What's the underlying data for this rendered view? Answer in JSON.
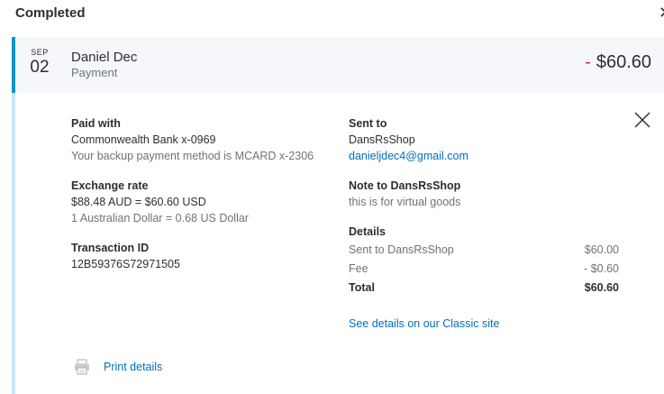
{
  "section": {
    "title": "Completed"
  },
  "transaction": {
    "date_month": "SEP",
    "date_day": "02",
    "party_name": "Daniel Dec",
    "type": "Payment",
    "amount_sign": "-",
    "amount": "$60.60"
  },
  "paid_with": {
    "label": "Paid with",
    "account": "Commonwealth Bank x-0969",
    "backup": "Your backup payment method is MCARD x-2306"
  },
  "exchange": {
    "label": "Exchange rate",
    "conversion": "$88.48 AUD = $60.60 USD",
    "rate": "1 Australian Dollar = 0.68 US Dollar"
  },
  "transaction_id": {
    "label": "Transaction ID",
    "value": "12B59376S72971505"
  },
  "sent_to": {
    "label": "Sent to",
    "name": "DansRsShop",
    "email": "danieljdec4@gmail.com"
  },
  "note": {
    "label": "Note to DansRsShop",
    "text": "this is for virtual goods"
  },
  "details": {
    "label": "Details",
    "rows": [
      {
        "name": "Sent to DansRsShop",
        "value": "$60.00"
      },
      {
        "name": "Fee",
        "value": "- $0.60"
      }
    ],
    "total_label": "Total",
    "total_value": "$60.60"
  },
  "links": {
    "classic": "See details on our Classic site",
    "print": "Print details"
  },
  "colors": {
    "accent": "#1394c8",
    "panel_border": "#c7e6f4",
    "link": "#0070ba",
    "negative": "#c72e2e"
  },
  "icons": {
    "top_close": "close-icon",
    "detail_close": "close-icon",
    "print": "printer-icon"
  }
}
